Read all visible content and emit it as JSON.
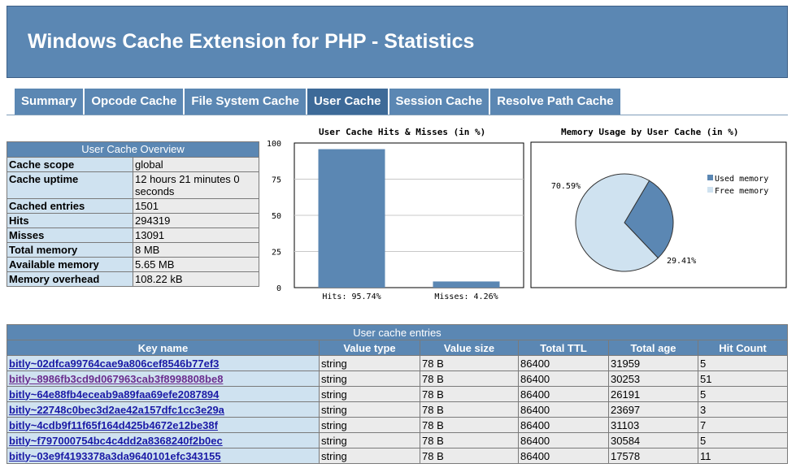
{
  "title": "Windows Cache Extension for PHP - Statistics",
  "tabs": [
    {
      "label": "Summary",
      "active": false
    },
    {
      "label": "Opcode Cache",
      "active": false
    },
    {
      "label": "File System Cache",
      "active": false
    },
    {
      "label": "User Cache",
      "active": true
    },
    {
      "label": "Session Cache",
      "active": false
    },
    {
      "label": "Resolve Path Cache",
      "active": false
    }
  ],
  "overview": {
    "caption": "User Cache Overview",
    "rows": [
      {
        "label": "Cache scope",
        "value": "global"
      },
      {
        "label": "Cache uptime",
        "value": "12 hours 21 minutes 0 seconds"
      },
      {
        "label": "Cached entries",
        "value": "1501"
      },
      {
        "label": "Hits",
        "value": "294319"
      },
      {
        "label": "Misses",
        "value": "13091"
      },
      {
        "label": "Total memory",
        "value": "8 MB"
      },
      {
        "label": "Available memory",
        "value": "5.65 MB"
      },
      {
        "label": "Memory overhead",
        "value": "108.22 kB"
      }
    ]
  },
  "chart_data": [
    {
      "type": "bar",
      "title": "User Cache Hits & Misses (in %)",
      "categories": [
        "Hits: 95.74%",
        "Misses: 4.26%"
      ],
      "values": [
        95.74,
        4.26
      ],
      "ylim": [
        0,
        100
      ],
      "yticks": [
        "0",
        "25",
        "50",
        "75",
        "100"
      ],
      "grid": true,
      "color": "#5b87b3"
    },
    {
      "type": "pie",
      "title": "Memory Usage by User Cache (in %)",
      "slices": [
        {
          "label": "Used memory",
          "value": 29.41,
          "text": "29.41%",
          "color": "#5b87b3"
        },
        {
          "label": "Free memory",
          "value": 70.59,
          "text": "70.59%",
          "color": "#cfe2f0"
        }
      ],
      "legend": "top-right"
    }
  ],
  "entries": {
    "caption": "User cache entries",
    "headers": [
      "Key name",
      "Value type",
      "Value size",
      "Total TTL",
      "Total age",
      "Hit Count"
    ],
    "rows": [
      {
        "key": "bitly~02dfca99764cae9a806cef8546b77ef3",
        "type": "string",
        "size": "78 B",
        "ttl": "86400",
        "age": "31959",
        "hits": "5",
        "visited": false
      },
      {
        "key": "bitly~8986fb3cd9d067963cab3f8998808be8",
        "type": "string",
        "size": "78 B",
        "ttl": "86400",
        "age": "30253",
        "hits": "51",
        "visited": true
      },
      {
        "key": "bitly~64e88fb4eceab9a89faa69efe2087894",
        "type": "string",
        "size": "78 B",
        "ttl": "86400",
        "age": "26191",
        "hits": "5",
        "visited": false
      },
      {
        "key": "bitly~22748c0bec3d2ae42a157dfc1cc3e29a",
        "type": "string",
        "size": "78 B",
        "ttl": "86400",
        "age": "23697",
        "hits": "3",
        "visited": false
      },
      {
        "key": "bitly~4cdb9f11f65f164d425b4672e12be38f",
        "type": "string",
        "size": "78 B",
        "ttl": "86400",
        "age": "31103",
        "hits": "7",
        "visited": false
      },
      {
        "key": "bitly~f797000754bc4c4dd2a8368240f2b0ec",
        "type": "string",
        "size": "78 B",
        "ttl": "86400",
        "age": "30584",
        "hits": "5",
        "visited": false
      },
      {
        "key": "bitly~03e9f4193378a3da9640101efc343155",
        "type": "string",
        "size": "78 B",
        "ttl": "86400",
        "age": "17578",
        "hits": "11",
        "visited": false
      }
    ]
  }
}
